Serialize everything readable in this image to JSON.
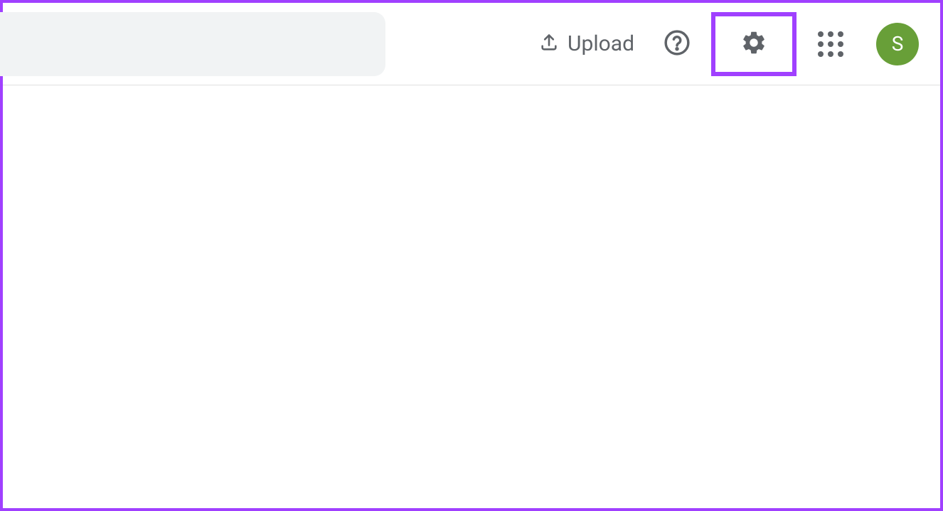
{
  "header": {
    "upload_label": "Upload",
    "avatar_initial": "S"
  },
  "colors": {
    "highlight": "#a040ff",
    "avatar_bg": "#689f38",
    "icon_color": "#5f6368",
    "search_bg": "#f1f3f4"
  }
}
